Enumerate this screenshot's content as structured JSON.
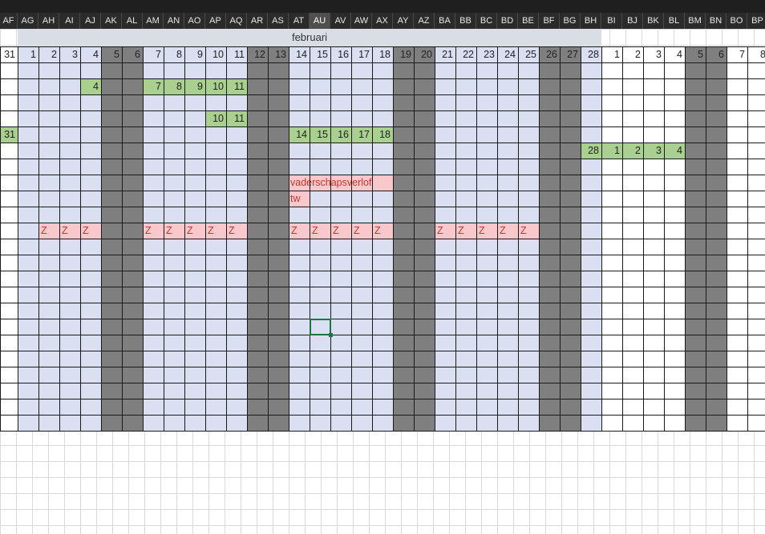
{
  "column_headers": [
    "AF",
    "AG",
    "AH",
    "AI",
    "AJ",
    "AK",
    "AL",
    "AM",
    "AN",
    "AO",
    "AP",
    "AQ",
    "AR",
    "AS",
    "AT",
    "AU",
    "AV",
    "AW",
    "AX",
    "AY",
    "AZ",
    "BA",
    "BB",
    "BC",
    "BD",
    "BE",
    "BF",
    "BG",
    "BH",
    "BI",
    "BJ",
    "BK",
    "BL",
    "BM",
    "BN",
    "BO",
    "BP"
  ],
  "selected_column": "AU",
  "month_label": "februari",
  "day_numbers": [
    "31",
    "1",
    "2",
    "3",
    "4",
    "5",
    "6",
    "7",
    "8",
    "9",
    "10",
    "11",
    "12",
    "13",
    "14",
    "15",
    "16",
    "17",
    "18",
    "19",
    "20",
    "21",
    "22",
    "23",
    "24",
    "25",
    "26",
    "27",
    "28",
    "1",
    "2",
    "3",
    "4",
    "5",
    "6",
    "7",
    "8"
  ],
  "grid_rows": 23,
  "colors": {
    "weekday_fill": "#dadff2",
    "weekend_fill": "#7f7f7f",
    "highlight_green": "#a9d08e",
    "highlight_red": "#f8c8cc",
    "red_text": "#c0392b",
    "gridline": "#1a1a1a",
    "empty_gridline": "#d9d9d9",
    "month_header_fill": "#d9dde4",
    "selection_border": "#217346"
  },
  "entries": [
    {
      "row": 1,
      "col": 4,
      "text": "4",
      "kind": "green"
    },
    {
      "row": 1,
      "col": 7,
      "text": "7",
      "kind": "green"
    },
    {
      "row": 1,
      "col": 8,
      "text": "8",
      "kind": "green"
    },
    {
      "row": 1,
      "col": 9,
      "text": "9",
      "kind": "green"
    },
    {
      "row": 1,
      "col": 10,
      "text": "10",
      "kind": "green"
    },
    {
      "row": 1,
      "col": 11,
      "text": "11",
      "kind": "green"
    },
    {
      "row": 3,
      "col": 10,
      "text": "10",
      "kind": "green"
    },
    {
      "row": 3,
      "col": 11,
      "text": "11",
      "kind": "green"
    },
    {
      "row": 4,
      "col": 0,
      "text": "31",
      "kind": "green"
    },
    {
      "row": 4,
      "col": 14,
      "text": "14",
      "kind": "green"
    },
    {
      "row": 4,
      "col": 15,
      "text": "15",
      "kind": "green"
    },
    {
      "row": 4,
      "col": 16,
      "text": "16",
      "kind": "green"
    },
    {
      "row": 4,
      "col": 17,
      "text": "17",
      "kind": "green"
    },
    {
      "row": 4,
      "col": 18,
      "text": "18",
      "kind": "green"
    },
    {
      "row": 5,
      "col": 28,
      "text": "28",
      "kind": "green"
    },
    {
      "row": 5,
      "col": 29,
      "text": "1",
      "kind": "green"
    },
    {
      "row": 5,
      "col": 30,
      "text": "2",
      "kind": "green"
    },
    {
      "row": 5,
      "col": 31,
      "text": "3",
      "kind": "green"
    },
    {
      "row": 5,
      "col": 32,
      "text": "4",
      "kind": "green"
    },
    {
      "row": 10,
      "col": 2,
      "text": "Z",
      "kind": "z"
    },
    {
      "row": 10,
      "col": 3,
      "text": "Z",
      "kind": "z"
    },
    {
      "row": 10,
      "col": 4,
      "text": "Z",
      "kind": "z"
    },
    {
      "row": 10,
      "col": 7,
      "text": "Z",
      "kind": "z"
    },
    {
      "row": 10,
      "col": 8,
      "text": "Z",
      "kind": "z"
    },
    {
      "row": 10,
      "col": 9,
      "text": "Z",
      "kind": "z"
    },
    {
      "row": 10,
      "col": 10,
      "text": "Z",
      "kind": "z"
    },
    {
      "row": 10,
      "col": 11,
      "text": "Z",
      "kind": "z"
    },
    {
      "row": 10,
      "col": 14,
      "text": "Z",
      "kind": "z"
    },
    {
      "row": 10,
      "col": 15,
      "text": "Z",
      "kind": "z"
    },
    {
      "row": 10,
      "col": 16,
      "text": "Z",
      "kind": "z"
    },
    {
      "row": 10,
      "col": 17,
      "text": "Z",
      "kind": "z"
    },
    {
      "row": 10,
      "col": 18,
      "text": "Z",
      "kind": "z"
    },
    {
      "row": 10,
      "col": 21,
      "text": "Z",
      "kind": "z"
    },
    {
      "row": 10,
      "col": 22,
      "text": "Z",
      "kind": "z"
    },
    {
      "row": 10,
      "col": 23,
      "text": "Z",
      "kind": "z"
    },
    {
      "row": 10,
      "col": 24,
      "text": "Z",
      "kind": "z"
    },
    {
      "row": 10,
      "col": 25,
      "text": "Z",
      "kind": "z"
    }
  ],
  "notes": [
    {
      "row": 7,
      "col": 14,
      "span": 5,
      "text": "vaderschapsverlof"
    },
    {
      "row": 8,
      "col": 14,
      "span": 1,
      "text": "tw"
    }
  ],
  "active_cell": {
    "row": 16,
    "col": 15
  }
}
